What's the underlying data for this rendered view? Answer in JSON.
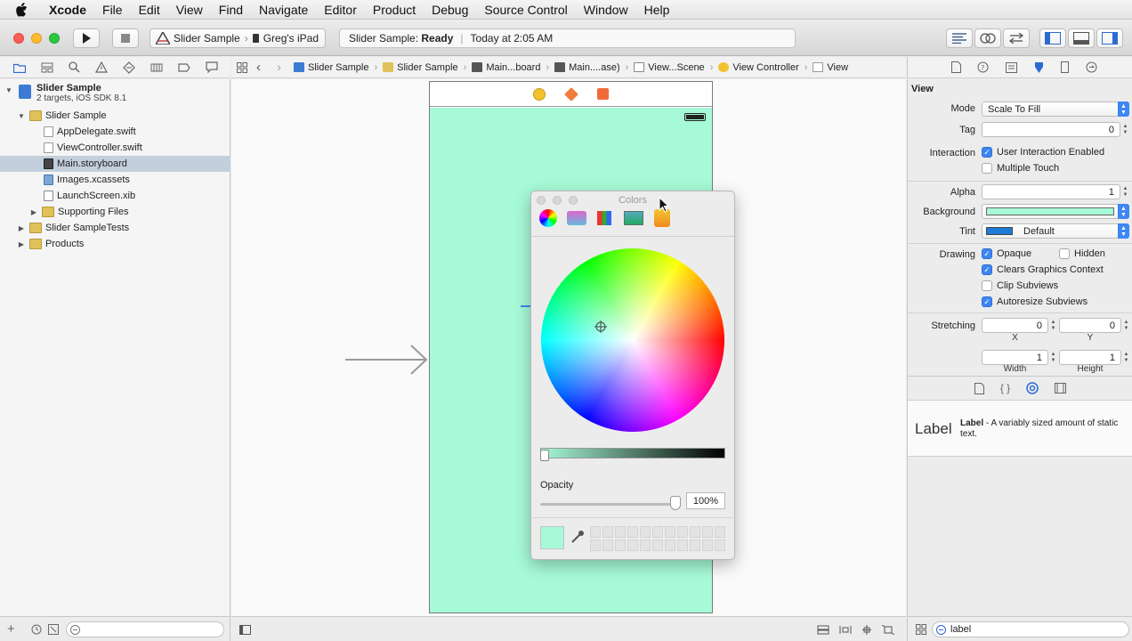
{
  "menubar": {
    "items": [
      "Xcode",
      "File",
      "Edit",
      "View",
      "Find",
      "Navigate",
      "Editor",
      "Product",
      "Debug",
      "Source Control",
      "Window",
      "Help"
    ]
  },
  "toolbar": {
    "scheme": "Slider Sample",
    "device": "Greg's iPad",
    "status_project": "Slider Sample:",
    "status_state": "Ready",
    "status_time": "Today at 2:05 AM"
  },
  "navigator": {
    "items": [
      {
        "label": "Slider Sample",
        "sub": "2 targets, iOS SDK 8.1",
        "kind": "project",
        "expanded": true
      },
      {
        "label": "Slider Sample",
        "kind": "folder",
        "expanded": true
      },
      {
        "label": "AppDelegate.swift",
        "kind": "swift"
      },
      {
        "label": "ViewController.swift",
        "kind": "swift"
      },
      {
        "label": "Main.storyboard",
        "kind": "storyboard",
        "selected": true
      },
      {
        "label": "Images.xcassets",
        "kind": "xcassets"
      },
      {
        "label": "LaunchScreen.xib",
        "kind": "xib"
      },
      {
        "label": "Supporting Files",
        "kind": "folder",
        "expanded": false
      },
      {
        "label": "Slider SampleTests",
        "kind": "folder",
        "expanded": false
      },
      {
        "label": "Products",
        "kind": "folder",
        "expanded": false
      }
    ]
  },
  "jumpbar": {
    "crumbs": [
      "Slider Sample",
      "Slider Sample",
      "Main...board",
      "Main....ase)",
      "View...Scene",
      "View Controller",
      "View"
    ]
  },
  "colors_panel": {
    "title": "Colors",
    "opacity_label": "Opacity",
    "opacity_value": "100%",
    "selected_color": "#a7fad7"
  },
  "inspector": {
    "section": "View",
    "mode_label": "Mode",
    "mode_value": "Scale To Fill",
    "tag_label": "Tag",
    "tag_value": "0",
    "interaction_label": "Interaction",
    "user_interaction": "User Interaction Enabled",
    "multiple_touch": "Multiple Touch",
    "alpha_label": "Alpha",
    "alpha_value": "1",
    "background_label": "Background",
    "background_color": "#a7fad7",
    "tint_label": "Tint",
    "tint_value": "Default",
    "tint_color": "#1e7bd6",
    "drawing_label": "Drawing",
    "opaque": "Opaque",
    "hidden": "Hidden",
    "clears_graphics": "Clears Graphics Context",
    "clip_subviews": "Clip Subviews",
    "autoresize_subviews": "Autoresize Subviews",
    "stretching_label": "Stretching",
    "stretch_x": "0",
    "stretch_y": "0",
    "x_label": "X",
    "y_label": "Y",
    "stretch_w": "1",
    "stretch_h": "1",
    "width_label": "Width",
    "height_label": "Height"
  },
  "library": {
    "item_icon_text": "Label",
    "item_title": "Label",
    "item_desc": "- A variably sized amount of static text.",
    "search_value": "label"
  }
}
